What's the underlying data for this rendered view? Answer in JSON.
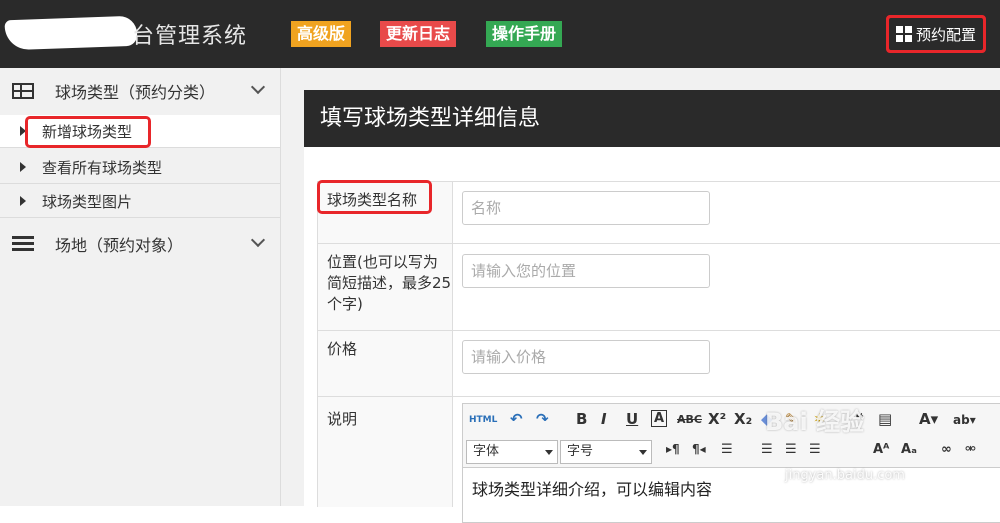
{
  "header": {
    "title": "台管理系统",
    "tags": [
      "高级版",
      "更新日志",
      "操作手册"
    ],
    "config_button": "预约配置"
  },
  "sidebar": {
    "groups": [
      {
        "label": "球场类型（预约分类）",
        "icon": "table-icon",
        "items": [
          "新增球场类型",
          "查看所有球场类型",
          "球场类型图片"
        ]
      },
      {
        "label": "场地（预约对象）",
        "icon": "list-icon",
        "items": []
      }
    ]
  },
  "panel": {
    "title": "填写球场类型详细信息",
    "fields": [
      {
        "label": "球场类型名称",
        "placeholder": "名称"
      },
      {
        "label": "位置(也可以写为简短描述，最多25个字)",
        "placeholder": "请输入您的位置"
      },
      {
        "label": "价格",
        "placeholder": "请输入价格"
      },
      {
        "label": "说明"
      }
    ],
    "editor": {
      "font_select": "字体",
      "size_select": "字号",
      "content": "球场类型详细介绍，可以编辑内容"
    }
  },
  "watermark": {
    "main": "Bai 经验",
    "sub": "jingyan.baidu.com"
  }
}
